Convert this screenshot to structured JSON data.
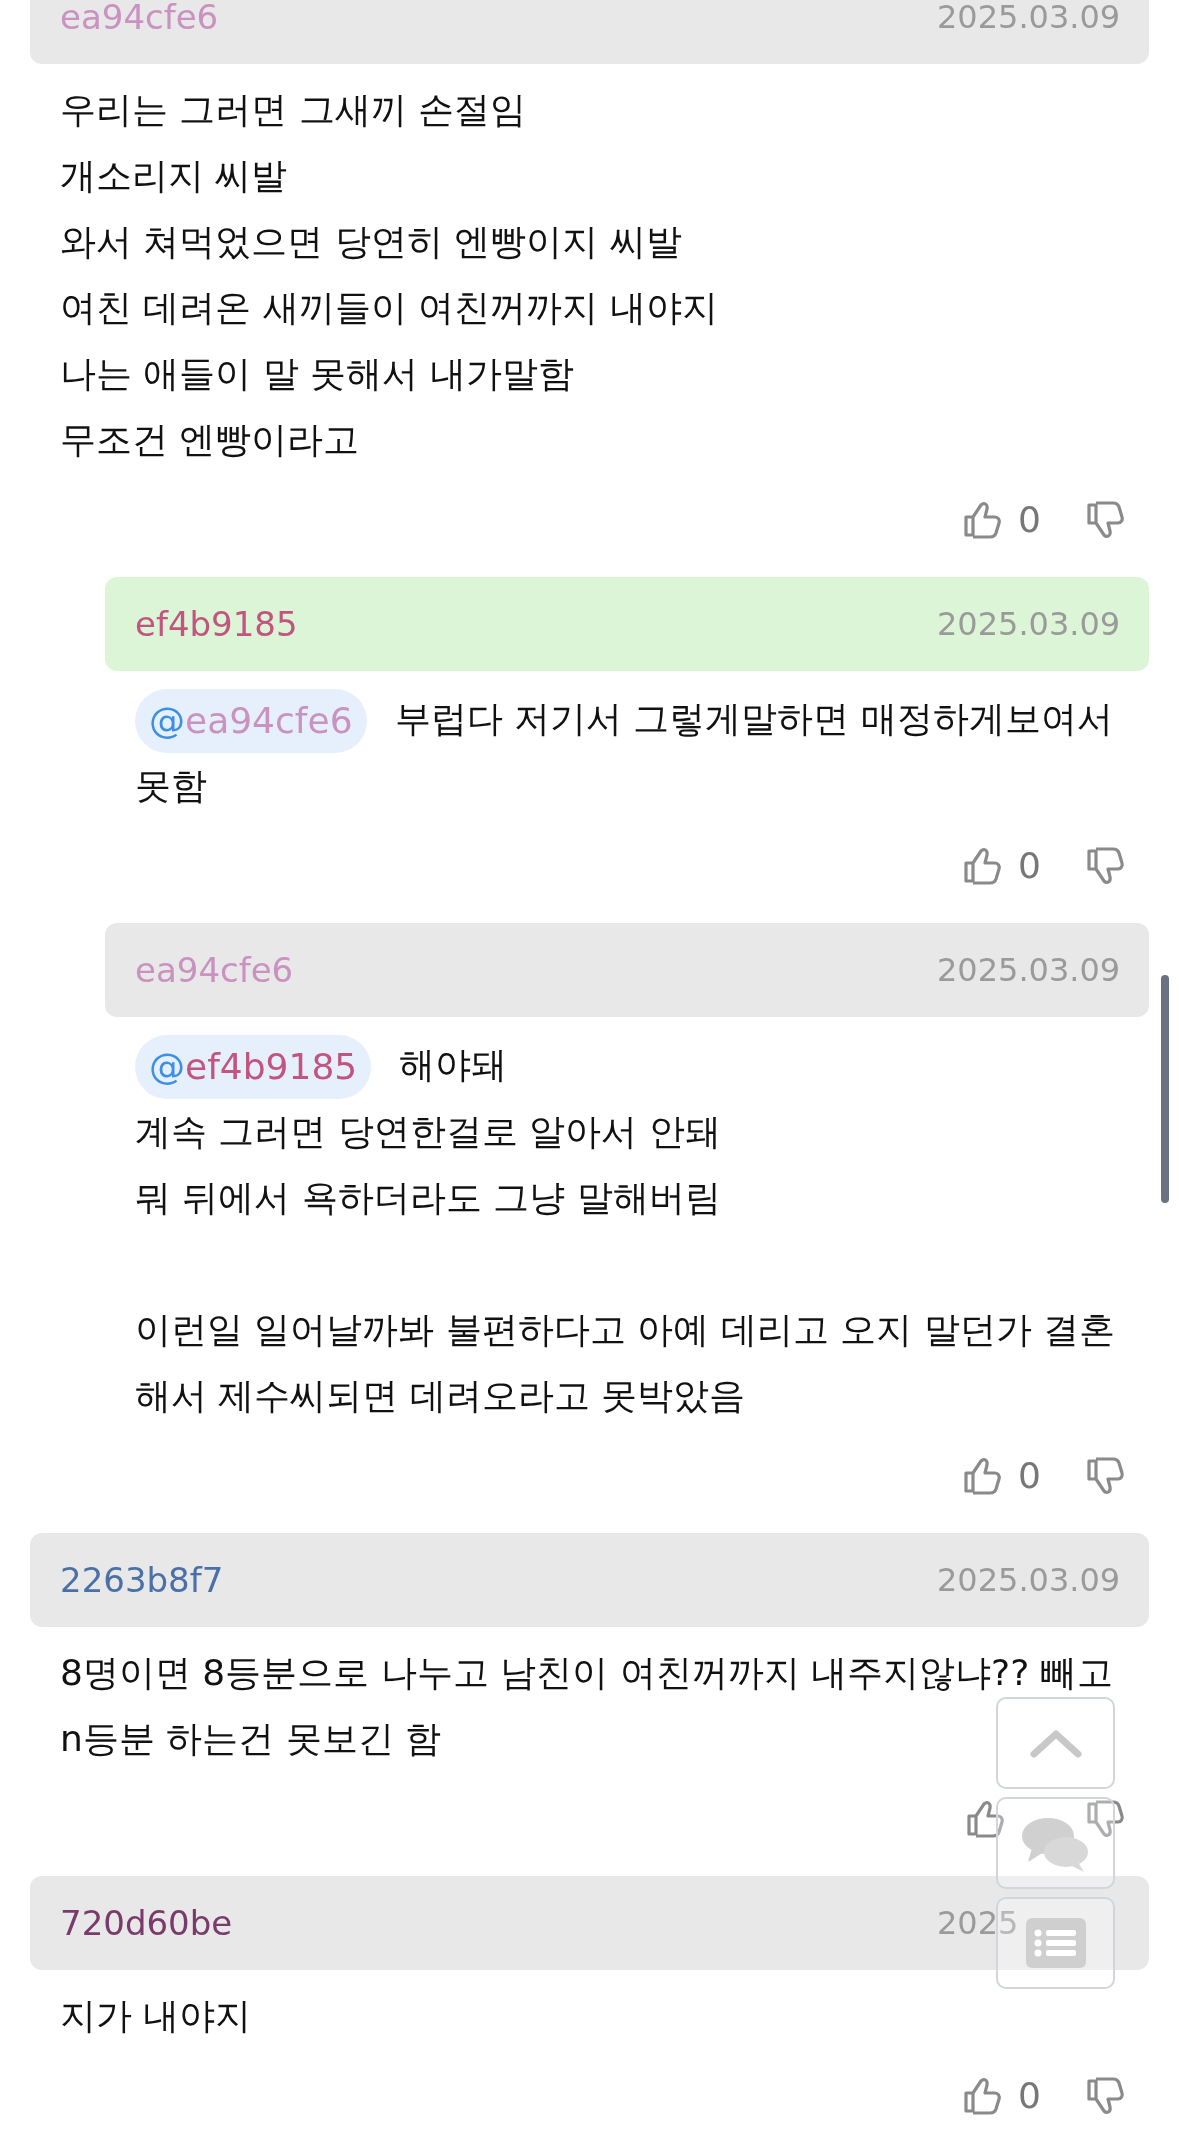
{
  "comments": [
    {
      "author": "ea94cfe6",
      "color": "#c992c0",
      "date": "2025.03.09",
      "highlighted": false,
      "paragraphs": [
        [
          "우리는 그러면 그새끼 손절임",
          "개소리지 씨발",
          "와서 쳐먹었으면 당연히 엔빵이지 씨발",
          "여친 데려온 새끼들이 여친꺼까지 내야지",
          "나는 애들이 말 못해서 내가말함",
          "무조건 엔빵이라고"
        ]
      ],
      "likes": "0",
      "replies": [
        {
          "author": "ef4b9185",
          "color": "#c2557f",
          "date": "2025.03.09",
          "highlighted": true,
          "mention": {
            "prefix": "@",
            "name": "ea94cfe6",
            "color": "#c992c0"
          },
          "paragraphs": [
            [
              "부럽다 저기서 그렇게말하면 매정하게보여서",
              "못함"
            ]
          ],
          "likes": "0"
        },
        {
          "author": "ea94cfe6",
          "color": "#c992c0",
          "date": "2025.03.09",
          "highlighted": false,
          "mention": {
            "prefix": "@",
            "name": "ef4b9185",
            "color": "#c2557f"
          },
          "paragraphs": [
            [
              "해야돼",
              "계속 그러면 당연한걸로 알아서 안돼",
              "뭐 뒤에서 욕하더라도 그냥 말해버림"
            ],
            [
              "이런일 일어날까봐 불편하다고 아예 데리고 오지 말던가 결혼",
              "해서 제수씨되면 데려오라고 못박았음"
            ]
          ],
          "likes": "0"
        }
      ]
    },
    {
      "author": "2263b8f7",
      "color": "#4a70a8",
      "date": "2025.03.09",
      "highlighted": false,
      "paragraphs": [
        [
          "8명이면 8등분으로 나누고 남친이 여친꺼까지 내주지않냐?? 빼고",
          "n등분 하는건 못보긴 함"
        ]
      ]
    },
    {
      "author": "720d60be",
      "color": "#7b3a6c",
      "date": "2025",
      "highlighted": false,
      "paragraphs": [
        [
          "지가 내야지"
        ]
      ],
      "likes": "0"
    }
  ]
}
